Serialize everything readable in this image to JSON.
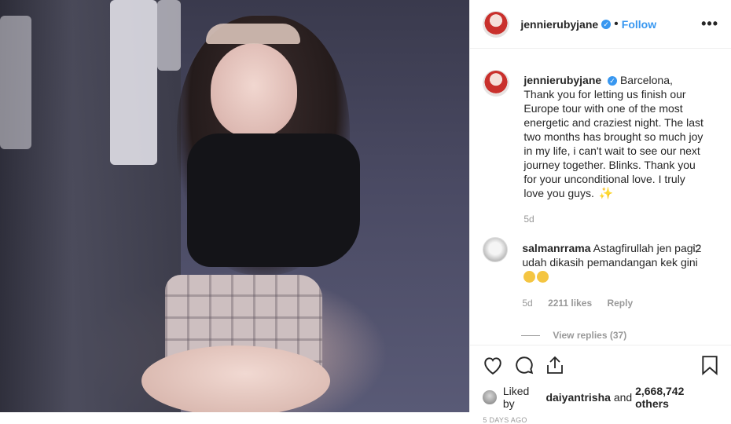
{
  "post": {
    "username": "jennierubyjane",
    "verified_icon": "verified-badge-icon",
    "follow_label": "Follow",
    "more_label": "•••"
  },
  "caption": {
    "username": "jennierubyjane",
    "text": "Barcelona, Thank you for letting us finish our Europe tour with one of the most energetic and craziest night. The last two months has brought so much joy in my life, i can't wait to see our next journey together. Blinks. Thank you for your unconditional love. I truly love you guys.",
    "age": "5d"
  },
  "comment": {
    "username": "salmanrrama",
    "text": "Astagfirullah jen pagi2 udah dikasih pemandangan kek gini",
    "age": "5d",
    "likes": "2211 likes",
    "reply_label": "Reply",
    "view_replies": "View replies (37)"
  },
  "likes": {
    "prefix": "Liked by",
    "user": "daiyantrisha",
    "joiner": "and",
    "count": "2,668,742 others"
  },
  "timestamp": "5 DAYS AGO",
  "colors": {
    "accent": "#3897f0",
    "muted": "#999999"
  }
}
